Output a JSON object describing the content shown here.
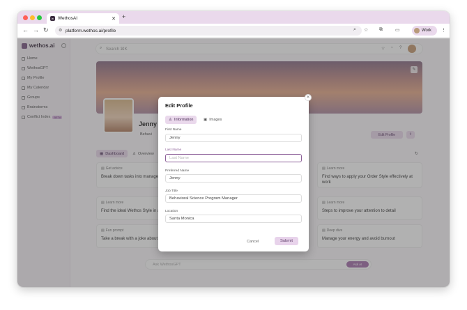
{
  "browser": {
    "tab_title": "WethosAI",
    "tab_close": "✕",
    "new_tab": "+",
    "url": "platform.wethos.ai/profile",
    "profile_label": "Work"
  },
  "sidebar": {
    "logo": "wethos.ai",
    "items": [
      {
        "label": "Home"
      },
      {
        "label": "WethosGPT"
      },
      {
        "label": "My Profile"
      },
      {
        "label": "My Calendar"
      },
      {
        "label": "Groups"
      },
      {
        "label": "Brainstorms"
      },
      {
        "label": "Conflict Index",
        "badge": "BETA"
      }
    ]
  },
  "header": {
    "search_placeholder": "Search ⌘K"
  },
  "profile": {
    "name": "Jenny",
    "job_short": "Behavi",
    "edit_profile_label": "Edit Profile",
    "tabs": [
      {
        "label": "Dashboard"
      },
      {
        "label": "Overview"
      }
    ]
  },
  "cards": [
    {
      "tag": "Get advice",
      "body": "Break down tasks into manageable"
    },
    {
      "tag": "Learn more",
      "body": "Find ways to apply your Order Style effectively at work"
    },
    {
      "tag": "Learn more",
      "body": "Find the ideal Wethos Style in a"
    },
    {
      "tag": "Learn more",
      "body": "Steps to improve your attention to detail"
    },
    {
      "tag": "Fun prompt",
      "body": "Take a break with a joke about"
    },
    {
      "tag": "Deep dive",
      "body": "Manage your energy and avoid burnout"
    }
  ],
  "ask_bar": {
    "placeholder": "Ask WethosGPT",
    "button": "Ask AI"
  },
  "modal": {
    "title": "Edit Profile",
    "close": "✕",
    "tabs": [
      {
        "label": "Information",
        "active": true
      },
      {
        "label": "Images",
        "active": false
      }
    ],
    "fields": {
      "first_name": {
        "label": "First Name",
        "value": "Jenny"
      },
      "last_name": {
        "label": "Last Name",
        "placeholder": "Last Name",
        "value": ""
      },
      "preferred_name": {
        "label": "Preferred Name",
        "value": "Jenny"
      },
      "job_title": {
        "label": "Job Title",
        "value": "Behavioral Science Program Manager"
      },
      "location": {
        "label": "Location",
        "value": "Santa Monica"
      }
    },
    "cancel_label": "Cancel",
    "submit_label": "Submit"
  },
  "colors": {
    "accent": "#8c5f98",
    "accent_light": "#ead9ec",
    "tab_strip": "#ead9ec"
  },
  "icons": [
    "search-icon",
    "star-icon",
    "extension-icon",
    "shield-icon",
    "edit-icon",
    "user-icon",
    "image-icon",
    "refresh-icon",
    "grid-icon"
  ]
}
